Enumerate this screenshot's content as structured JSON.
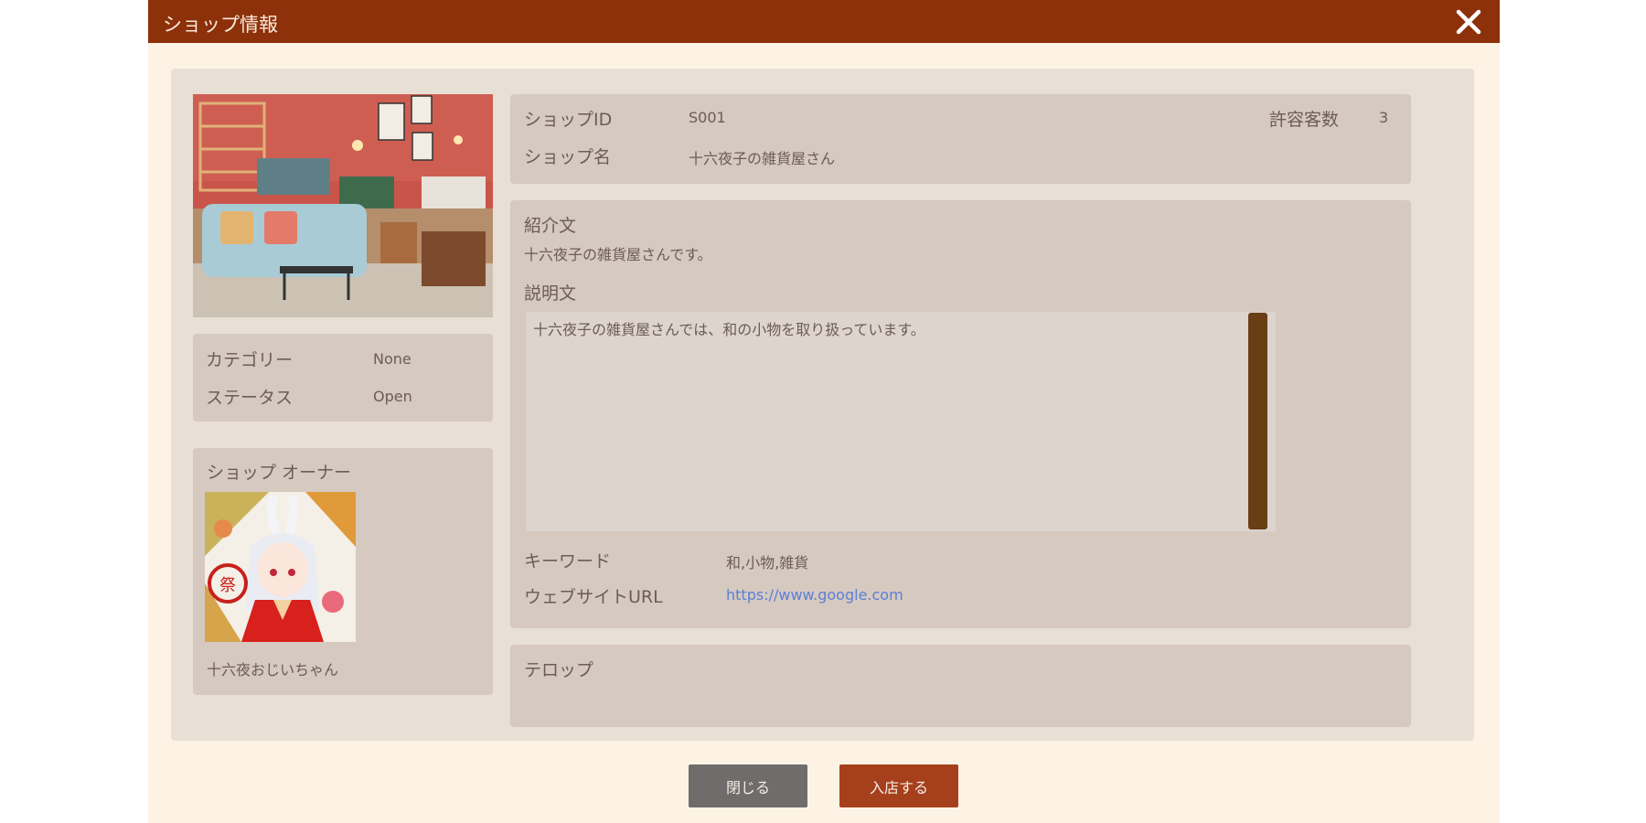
{
  "window": {
    "title": "ショップ情報",
    "close_icon": "close-icon"
  },
  "shop": {
    "id_label": "ショップID",
    "id_value": "S001",
    "capacity_label": "許容客数",
    "capacity_value": "3",
    "name_label": "ショップ名",
    "name_value": "十六夜子の雑貨屋さん",
    "category_label": "カテゴリー",
    "category_value": "None",
    "status_label": "ステータス",
    "status_value": "Open",
    "intro_label": "紹介文",
    "intro_value": "十六夜子の雑貨屋さんです。",
    "description_label": "説明文",
    "description_value": "十六夜子の雑貨屋さんでは、和の小物を取り扱っています。",
    "keyword_label": "キーワード",
    "keyword_value": "和,小物,雑貨",
    "website_label": "ウェブサイトURL",
    "website_value": "https://www.google.com",
    "ticker_label": "テロップ",
    "ticker_value": ""
  },
  "owner": {
    "section_label": "ショップ オーナー",
    "name": "十六夜おじいちゃん"
  },
  "buttons": {
    "close_label": "閉じる",
    "enter_label": "入店する"
  },
  "colors": {
    "titlebar": "#8c310a",
    "dialog_bg": "#fdf3e4",
    "content_bg": "#e8dfd5",
    "panel_bg": "#d5c9c0",
    "scrollbar": "#6a3e15",
    "link": "#5b7fd6",
    "close_button": "#6f6c6b",
    "enter_button": "#a6401c"
  }
}
